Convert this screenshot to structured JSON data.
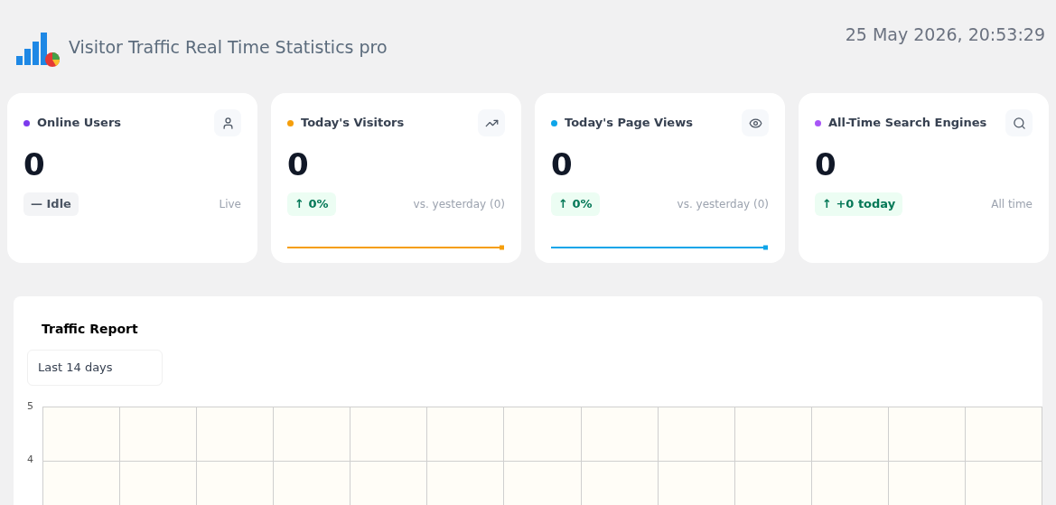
{
  "header": {
    "title": "Visitor Traffic Real Time Statistics pro",
    "datetime": "25 May 2026, 20:53:29"
  },
  "cards": [
    {
      "label": "Online Users",
      "color": "#7c3aed",
      "kind": "users",
      "value": "0",
      "badge": {
        "kind": "neutral",
        "text": "— Idle"
      },
      "note": "Live",
      "sparkline": false
    },
    {
      "label": "Today's Visitors",
      "color": "#f59e0b",
      "kind": "visitors",
      "value": "0",
      "badge": {
        "kind": "up",
        "text": "↑ 0%"
      },
      "note": "vs. yesterday (0)",
      "sparkline": true
    },
    {
      "label": "Today's Page Views",
      "color": "#0ea5e9",
      "kind": "pageviews",
      "value": "0",
      "badge": {
        "kind": "up",
        "text": "↑ 0%"
      },
      "note": "vs. yesterday (0)",
      "sparkline": true
    },
    {
      "label": "All-Time Search Engines",
      "color": "#a855f7",
      "kind": "engines",
      "value": "0",
      "badge": {
        "kind": "up",
        "text": "↑ +0 today"
      },
      "note": "All time",
      "sparkline": false
    }
  ],
  "report": {
    "title": "Traffic Report",
    "range": "Last 14 days",
    "y_tick_labels": [
      "5",
      "4"
    ]
  }
}
